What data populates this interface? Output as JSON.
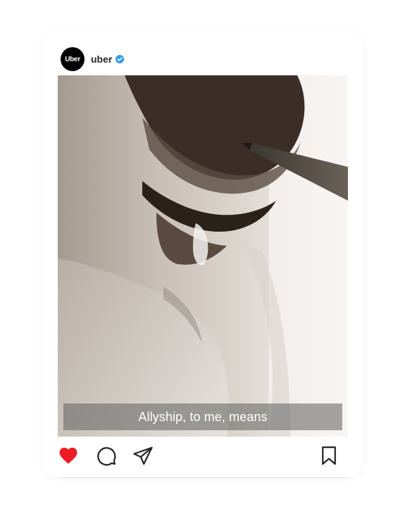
{
  "post": {
    "avatar_text": "Uber",
    "username": "uber",
    "verified_icon": "verified-badge-icon",
    "caption": "Allyship, to me, means"
  },
  "actions": [
    {
      "icon": "heart-icon",
      "state": "liked"
    },
    {
      "icon": "comment-icon"
    },
    {
      "icon": "share-icon"
    },
    {
      "icon": "bookmark-icon"
    }
  ],
  "colors": {
    "like": "#ed1c24",
    "verified": "#3897f0",
    "icon_stroke": "#262626"
  }
}
